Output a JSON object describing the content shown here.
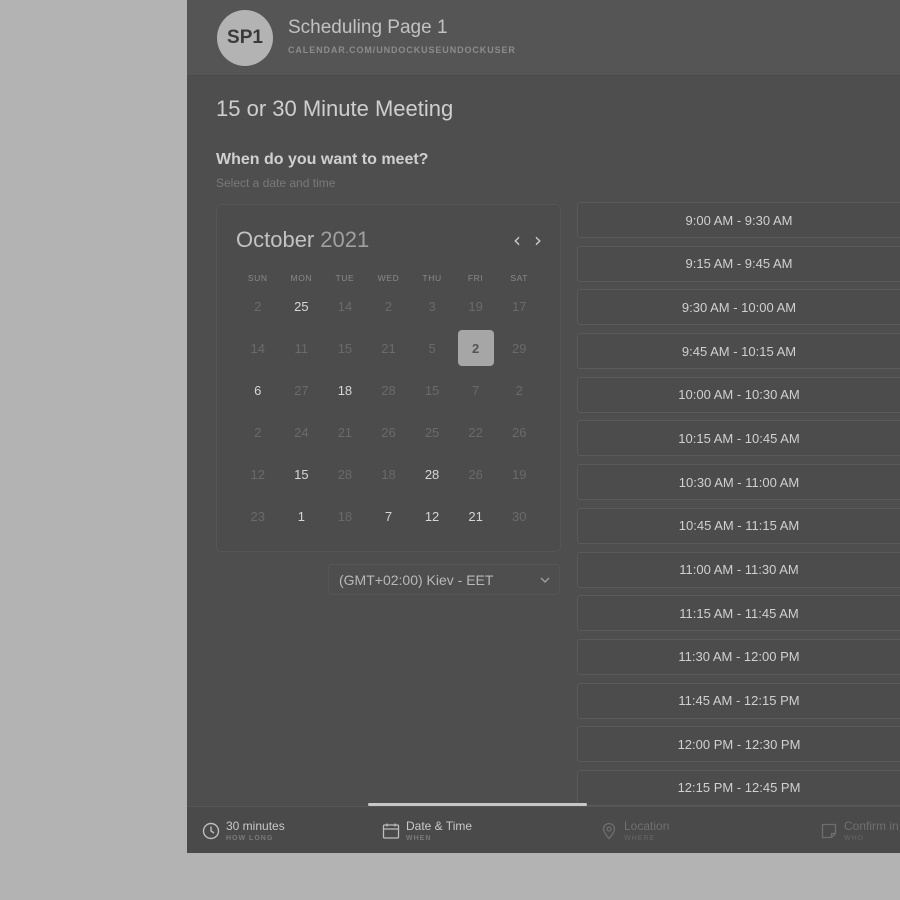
{
  "header": {
    "avatar_initials": "SP1",
    "title": "Scheduling Page 1",
    "url": "CALENDAR.COM/UNDOCKUSEUNDOCKUSER"
  },
  "meeting": {
    "title": "15 or 30 Minute Meeting",
    "question": "When do you want to meet?",
    "subtitle": "Select a date and time"
  },
  "calendar": {
    "month": "October",
    "year": "2021",
    "prev_icon": "chevron-left-icon",
    "next_icon": "chevron-right-icon",
    "weekdays": [
      "SUN",
      "MON",
      "TUE",
      "WED",
      "THU",
      "FRI",
      "SAT"
    ],
    "days": [
      {
        "n": "2",
        "s": "muted"
      },
      {
        "n": "25",
        "s": "active"
      },
      {
        "n": "14",
        "s": "muted"
      },
      {
        "n": "2",
        "s": "muted"
      },
      {
        "n": "3",
        "s": "muted"
      },
      {
        "n": "19",
        "s": "muted"
      },
      {
        "n": "17",
        "s": "muted"
      },
      {
        "n": "14",
        "s": "muted"
      },
      {
        "n": "11",
        "s": "muted"
      },
      {
        "n": "15",
        "s": "muted"
      },
      {
        "n": "21",
        "s": "muted"
      },
      {
        "n": "5",
        "s": "muted"
      },
      {
        "n": "2",
        "s": "selected"
      },
      {
        "n": "29",
        "s": "muted"
      },
      {
        "n": "6",
        "s": "active"
      },
      {
        "n": "27",
        "s": "muted"
      },
      {
        "n": "18",
        "s": "active"
      },
      {
        "n": "28",
        "s": "muted"
      },
      {
        "n": "15",
        "s": "muted"
      },
      {
        "n": "7",
        "s": "muted"
      },
      {
        "n": "2",
        "s": "muted"
      },
      {
        "n": "2",
        "s": "muted"
      },
      {
        "n": "24",
        "s": "muted"
      },
      {
        "n": "21",
        "s": "muted"
      },
      {
        "n": "26",
        "s": "muted"
      },
      {
        "n": "25",
        "s": "muted"
      },
      {
        "n": "22",
        "s": "muted"
      },
      {
        "n": "26",
        "s": "muted"
      },
      {
        "n": "12",
        "s": "muted"
      },
      {
        "n": "15",
        "s": "active"
      },
      {
        "n": "28",
        "s": "muted"
      },
      {
        "n": "18",
        "s": "muted"
      },
      {
        "n": "28",
        "s": "active"
      },
      {
        "n": "26",
        "s": "muted"
      },
      {
        "n": "19",
        "s": "muted"
      },
      {
        "n": "23",
        "s": "muted"
      },
      {
        "n": "1",
        "s": "active"
      },
      {
        "n": "18",
        "s": "muted"
      },
      {
        "n": "7",
        "s": "active"
      },
      {
        "n": "12",
        "s": "active"
      },
      {
        "n": "21",
        "s": "active"
      },
      {
        "n": "30",
        "s": "muted"
      }
    ]
  },
  "timezone": {
    "value": "(GMT+02:00) Kiev - EET",
    "icon": "chevron-down-icon"
  },
  "time_slots": [
    "9:00 AM - 9:30 AM",
    "9:15 AM - 9:45 AM",
    "9:30 AM - 10:00 AM",
    "9:45 AM - 10:15 AM",
    "10:00 AM - 10:30 AM",
    "10:15 AM - 10:45 AM",
    "10:30 AM - 11:00 AM",
    "10:45 AM - 11:15 AM",
    "11:00 AM - 11:30 AM",
    "11:15 AM - 11:45 AM",
    "11:30 AM - 12:00 PM",
    "11:45 AM - 12:15 PM",
    "12:00 PM - 12:30 PM",
    "12:15 PM - 12:45 PM"
  ],
  "footer": {
    "steps": [
      {
        "label": "30 minutes",
        "sub": "HOW LONG",
        "icon": "clock-icon"
      },
      {
        "label": "Date & Time",
        "sub": "WHEN",
        "icon": "calendar-icon"
      },
      {
        "label": "Location",
        "sub": "WHERE",
        "icon": "location-pin-icon"
      },
      {
        "label": "Confirm in",
        "sub": "WHO",
        "icon": "note-icon"
      }
    ]
  }
}
